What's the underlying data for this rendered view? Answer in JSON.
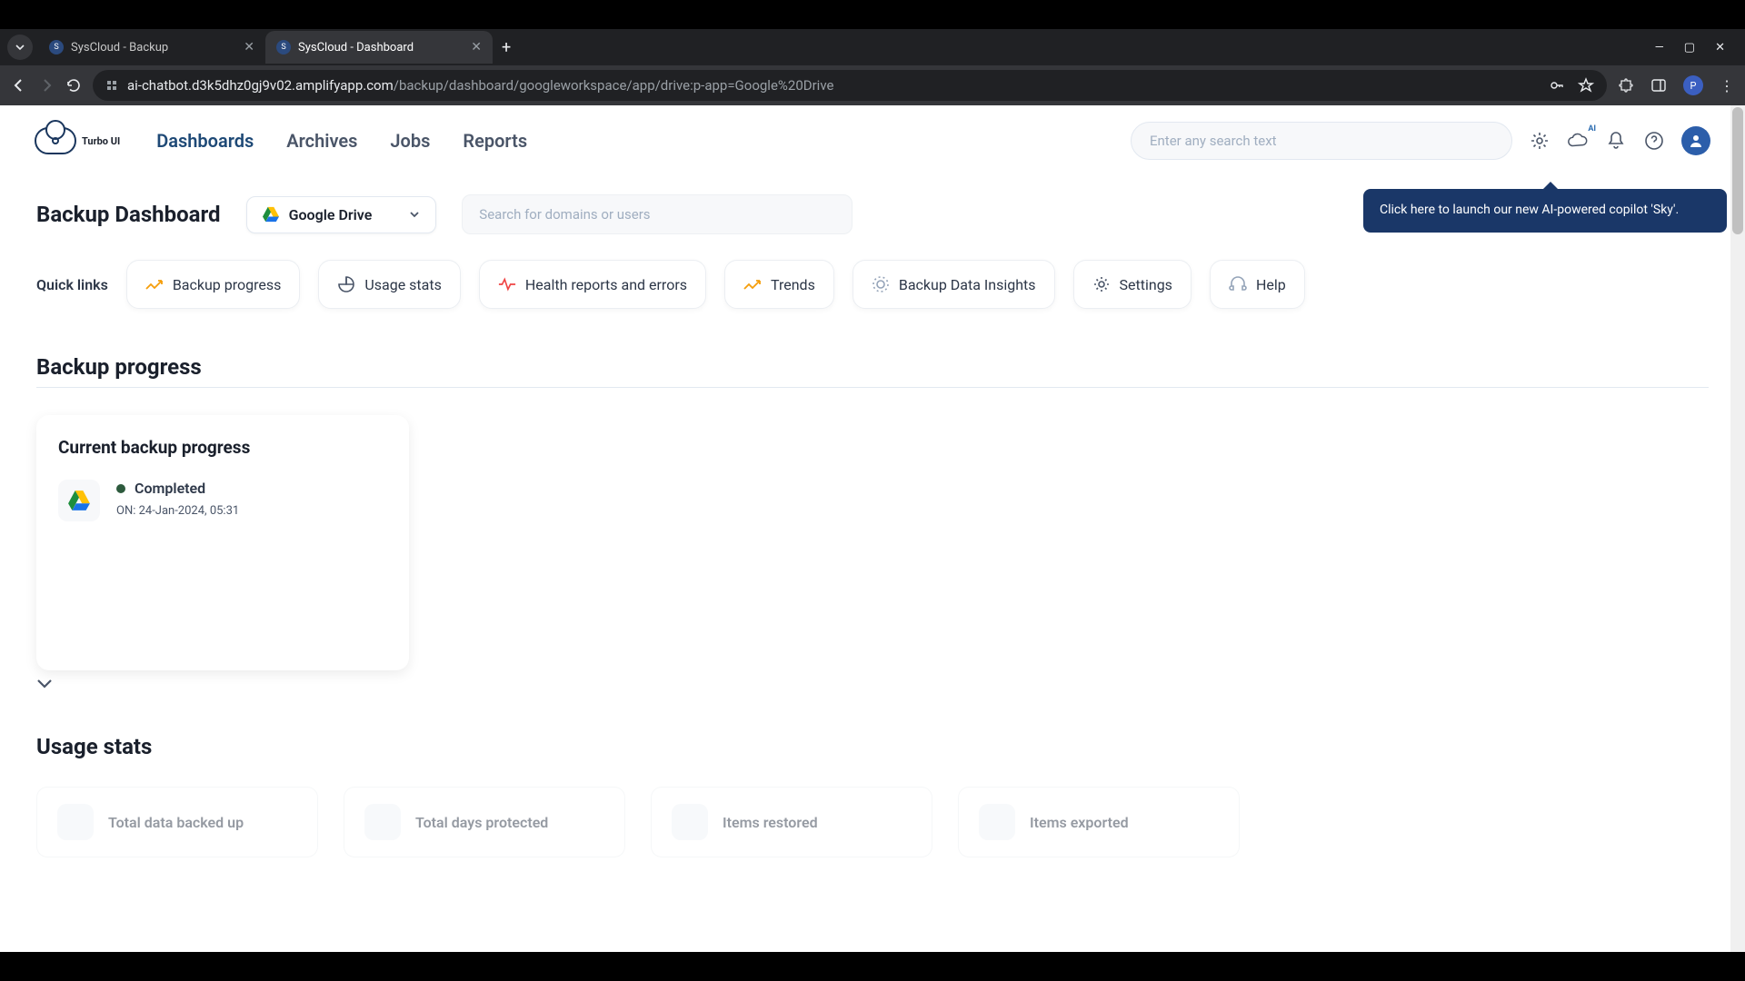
{
  "browser": {
    "tabs": [
      {
        "title": "SysCloud - Backup",
        "active": false
      },
      {
        "title": "SysCloud - Dashboard",
        "active": true
      }
    ],
    "url_host": "ai-chatbot.d3k5dhz0gj9v02.amplifyapp.com",
    "url_path": "/backup/dashboard/googleworkspace/app/drive:p-app=Google%20Drive",
    "avatar_letter": "P"
  },
  "header": {
    "logo_text": "Turbo UI",
    "nav": [
      "Dashboards",
      "Archives",
      "Jobs",
      "Reports"
    ],
    "active_nav": "Dashboards",
    "search_placeholder": "Enter any search text",
    "ai_badge": "AI"
  },
  "tooltip": {
    "text": "Click here to launch our new AI-powered copilot 'Sky'."
  },
  "page": {
    "title": "Backup Dashboard",
    "selector": {
      "label": "Google Drive"
    },
    "domain_search_placeholder": "Search for domains or users"
  },
  "quick_links": {
    "label": "Quick links",
    "items": [
      {
        "label": "Backup progress",
        "icon": "trending"
      },
      {
        "label": "Usage stats",
        "icon": "pie"
      },
      {
        "label": "Health reports and errors",
        "icon": "activity"
      },
      {
        "label": "Trends",
        "icon": "trending"
      },
      {
        "label": "Backup Data Insights",
        "icon": "insights"
      },
      {
        "label": "Settings",
        "icon": "gear"
      },
      {
        "label": "Help",
        "icon": "headphones"
      }
    ]
  },
  "sections": {
    "backup_progress": {
      "title": "Backup progress",
      "card_title": "Current backup progress",
      "status_label": "Completed",
      "timestamp": "ON: 24-Jan-2024, 05:31"
    },
    "usage_stats": {
      "title": "Usage stats",
      "cards": [
        "Total data backed up",
        "Total days protected",
        "Items restored",
        "Items exported"
      ]
    }
  }
}
